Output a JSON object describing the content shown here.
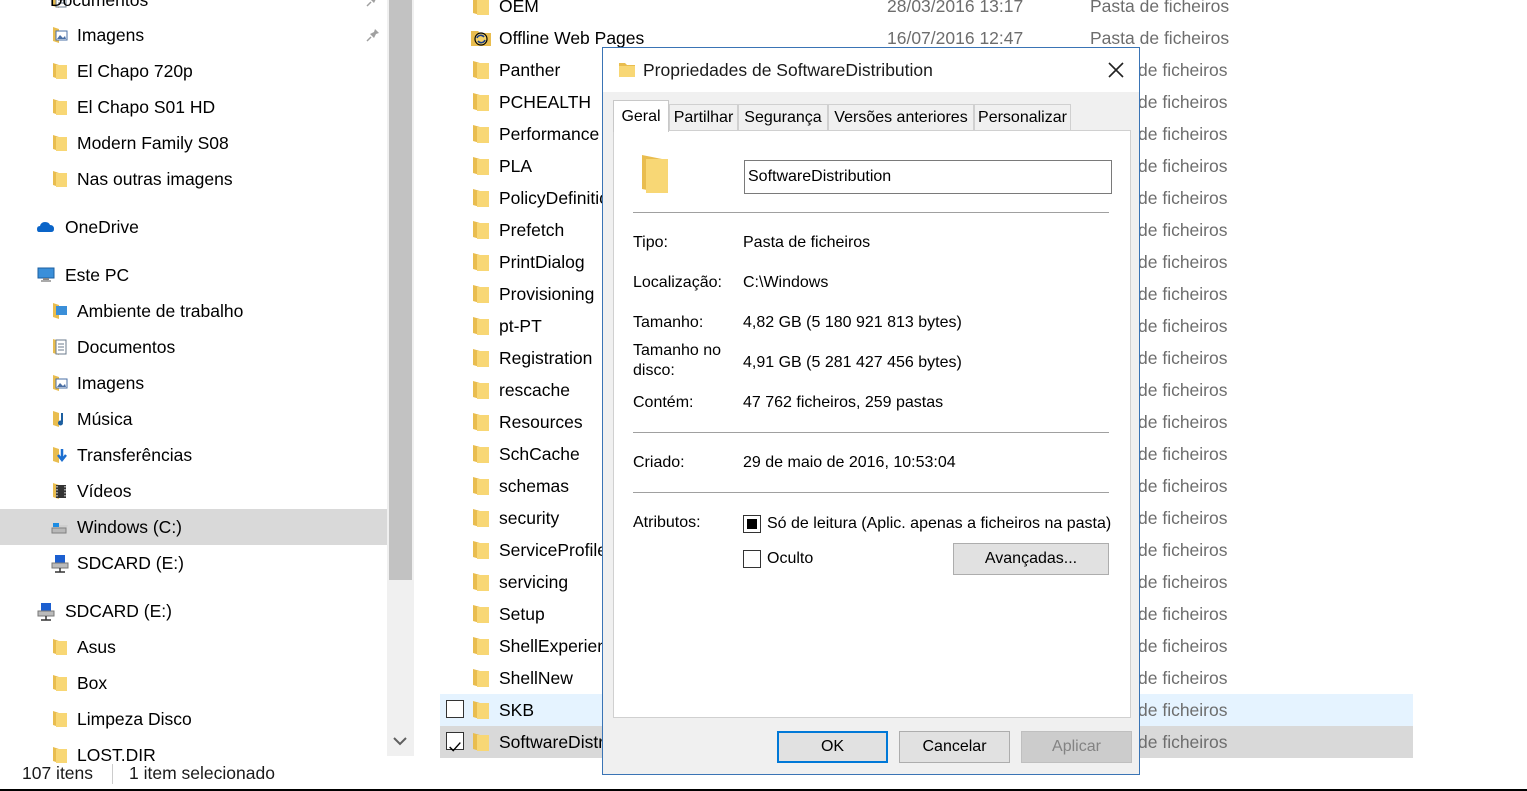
{
  "nav": {
    "items": [
      {
        "label": "Documentos",
        "icon": "documents-icon",
        "pinned": true
      },
      {
        "label": "Imagens",
        "icon": "pictures-icon",
        "pinned": true
      },
      {
        "label": "El Chapo 720p",
        "icon": "folder-icon"
      },
      {
        "label": "El Chapo S01 HD",
        "icon": "folder-icon"
      },
      {
        "label": "Modern Family S08",
        "icon": "folder-icon"
      },
      {
        "label": "Nas outras imagens",
        "icon": "folder-icon"
      },
      {
        "label": "OneDrive",
        "icon": "onedrive-cloud-icon"
      },
      {
        "label": "Este PC",
        "icon": "this-pc-icon"
      },
      {
        "label": "Ambiente de trabalho",
        "icon": "desktop-folder-icon"
      },
      {
        "label": "Documentos",
        "icon": "documents-icon"
      },
      {
        "label": "Imagens",
        "icon": "pictures-icon"
      },
      {
        "label": "Música",
        "icon": "music-icon"
      },
      {
        "label": "Transferências",
        "icon": "downloads-icon"
      },
      {
        "label": "Vídeos",
        "icon": "videos-icon"
      },
      {
        "label": "Windows (C:)",
        "icon": "drive-c-icon",
        "selected": true
      },
      {
        "label": "SDCARD (E:)",
        "icon": "network-drive-icon"
      },
      {
        "label": "SDCARD (E:)",
        "icon": "network-drive-icon"
      },
      {
        "label": "Asus",
        "icon": "folder-icon"
      },
      {
        "label": "Box",
        "icon": "folder-icon"
      },
      {
        "label": "Limpeza Disco",
        "icon": "folder-icon"
      },
      {
        "label": "LOST.DIR",
        "icon": "folder-icon"
      }
    ]
  },
  "files": {
    "rows": [
      {
        "name": "OEM",
        "date": "28/03/2016 13:17",
        "type": "Pasta de ficheiros"
      },
      {
        "name": "Offline Web Pages",
        "date": "16/07/2016 12:47",
        "type": "Pasta de ficheiros",
        "special": true
      },
      {
        "name": "Panther",
        "type": "de ficheiros"
      },
      {
        "name": "PCHEALTH",
        "type": "de ficheiros"
      },
      {
        "name": "Performance",
        "type": "de ficheiros"
      },
      {
        "name": "PLA",
        "type": "de ficheiros"
      },
      {
        "name": "PolicyDefinitio",
        "type": "de ficheiros"
      },
      {
        "name": "Prefetch",
        "type": "de ficheiros"
      },
      {
        "name": "PrintDialog",
        "type": "de ficheiros"
      },
      {
        "name": "Provisioning",
        "type": "de ficheiros"
      },
      {
        "name": "pt-PT",
        "type": "de ficheiros"
      },
      {
        "name": "Registration",
        "type": "de ficheiros"
      },
      {
        "name": "rescache",
        "type": "de ficheiros"
      },
      {
        "name": "Resources",
        "type": "de ficheiros"
      },
      {
        "name": "SchCache",
        "type": "de ficheiros"
      },
      {
        "name": "schemas",
        "type": "de ficheiros"
      },
      {
        "name": "security",
        "type": "de ficheiros"
      },
      {
        "name": "ServiceProfile",
        "type": "de ficheiros"
      },
      {
        "name": "servicing",
        "type": "de ficheiros"
      },
      {
        "name": "Setup",
        "type": "de ficheiros"
      },
      {
        "name": "ShellExperien",
        "type": "de ficheiros"
      },
      {
        "name": "ShellNew",
        "type": "de ficheiros"
      },
      {
        "name": "SKB",
        "type": "de ficheiros",
        "state": "hover"
      },
      {
        "name": "SoftwareDistri",
        "type": "de ficheiros",
        "state": "selected"
      }
    ]
  },
  "status": {
    "count": "107 itens",
    "selection": "1 item selecionado"
  },
  "dialog": {
    "title": "Propriedades de SoftwareDistribution",
    "tabs": [
      "Geral",
      "Partilhar",
      "Segurança",
      "Versões anteriores",
      "Personalizar"
    ],
    "folder_name": "SoftwareDistribution",
    "labels": {
      "type": "Tipo:",
      "location": "Localização:",
      "size": "Tamanho:",
      "size_on_disk_1": "Tamanho no",
      "size_on_disk_2": "disco:",
      "contains": "Contém:",
      "created": "Criado:",
      "attributes": "Atributos:"
    },
    "values": {
      "type": "Pasta de ficheiros",
      "location": "C:\\Windows",
      "size": "4,82 GB (5 180 921 813 bytes)",
      "size_on_disk": "4,91 GB (5 281 427 456 bytes)",
      "contains": "47 762 ficheiros, 259 pastas",
      "created": "29 de maio de 2016, 10:53:04"
    },
    "attributes": {
      "readonly_label": "Só de leitura (Aplic. apenas a ficheiros na pasta)",
      "hidden_label": "Oculto",
      "advanced_label": "Avançadas..."
    },
    "buttons": {
      "ok": "OK",
      "cancel": "Cancelar",
      "apply": "Aplicar"
    }
  },
  "colors": {
    "accent": "#0078d7",
    "folder": "#e9bd4f",
    "selection": "#d9d9d9",
    "hover": "#e5f3ff"
  }
}
